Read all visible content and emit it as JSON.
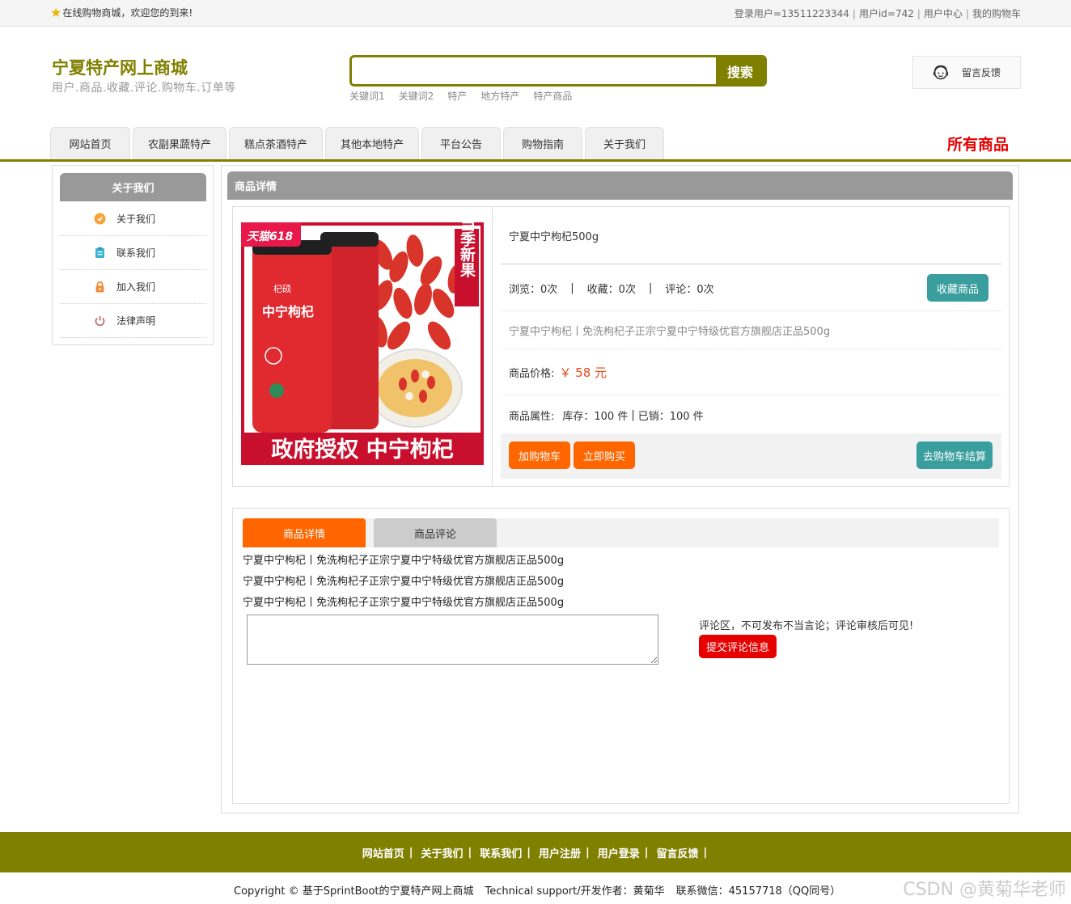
{
  "topbar": {
    "welcome": "在线购物商城，欢迎您的到来!",
    "login_user": "登录用户=13511223344",
    "user_id": "用户id=742",
    "user_center": "用户中心",
    "my_cart": "我的购物车"
  },
  "header": {
    "site_title": "宁夏特产网上商城",
    "site_subtitle": "用户.商品.收藏.评论.购物车.订单等",
    "search_value": "",
    "search_button": "搜索",
    "hot_keywords": [
      "关键词1",
      "关键词2",
      "特产",
      "地方特产",
      "特产商品"
    ],
    "feedback": "留言反馈"
  },
  "nav": {
    "tabs": [
      "网站首页",
      "农副果蔬特产",
      "糕点茶酒特产",
      "其他本地特产",
      "平台公告",
      "购物指南",
      "关于我们"
    ],
    "all_goods": "所有商品"
  },
  "sidebar": {
    "title": "关于我们",
    "items": [
      {
        "label": "关于我们",
        "icon": "info-circle-icon",
        "color": "#f5a33a"
      },
      {
        "label": "联系我们",
        "icon": "clipboard-icon",
        "color": "#3bb3d6"
      },
      {
        "label": "加入我们",
        "icon": "lock-icon",
        "color": "#f08c3a"
      },
      {
        "label": "法律声明",
        "icon": "power-icon",
        "color": "#c07070"
      }
    ]
  },
  "product": {
    "panel_title": "商品详情",
    "image_texts": {
      "badge": "天猫618",
      "side": "当季新果",
      "banner": "政府授权 中宁枸杞",
      "jar_label": "中宁枸杞",
      "brand": "杞硕"
    },
    "name": "宁夏中宁枸杞500g",
    "views": "浏览：0次",
    "favorites": "收藏：0次",
    "comments": "评论：0次",
    "favorite_button": "收藏商品",
    "subtitle": "宁夏中宁枸杞丨免洗枸杞子正宗宁夏中宁特级优官方旗舰店正品500g",
    "price_label": "商品价格:",
    "price_value": "￥ 58 元",
    "attr_label": "商品属性:",
    "stock": "库存：100 件",
    "sold": "已销：100 件",
    "add_cart": "加购物车",
    "buy_now": "立即购买",
    "checkout": "去购物车结算"
  },
  "detail": {
    "tab_detail": "商品详情",
    "tab_comments": "商品评论",
    "lines": [
      "宁夏中宁枸杞丨免洗枸杞子正宗宁夏中宁特级优官方旗舰店正品500g",
      "宁夏中宁枸杞丨免洗枸杞子正宗宁夏中宁特级优官方旗舰店正品500g",
      "宁夏中宁枸杞丨免洗枸杞子正宗宁夏中宁特级优官方旗舰店正品500g"
    ],
    "comment_value": "",
    "comment_note": "评论区，不可发布不当言论；评论审核后可见!",
    "submit": "提交评论信息"
  },
  "footer": {
    "links": [
      "网站首页",
      "关于我们",
      "联系我们",
      "用户注册",
      "用户登录",
      "留言反馈"
    ],
    "copyright": "Copyright © 基于SprintBoot的宁夏特产网上商城",
    "support": "Technical support/开发作者：黄菊华",
    "contact": "联系微信：45157718（QQ同号）",
    "watermark": "CSDN @黄菊华老师"
  },
  "colors": {
    "brand": "#808000",
    "orange": "#ff6600",
    "teal": "#3a9e9e",
    "red": "#e60000"
  }
}
